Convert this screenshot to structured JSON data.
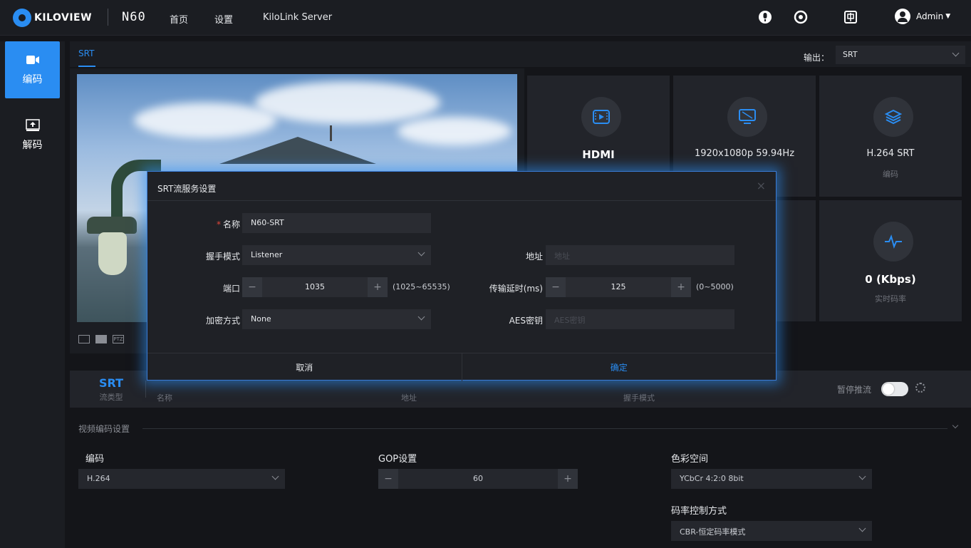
{
  "topbar": {
    "brand": "KILOVIEW",
    "model": "N60",
    "nav": [
      "首页",
      "设置",
      "KiloLink Server"
    ],
    "user": "Admin"
  },
  "sidebar": {
    "items": [
      {
        "label": "编码",
        "icon": "camera-icon",
        "active": true
      },
      {
        "label": "解码",
        "icon": "upload-icon",
        "active": false
      }
    ]
  },
  "main": {
    "tab": "SRT",
    "output_label": "输出：",
    "output_value": "SRT"
  },
  "preview": {
    "icons": [
      "layout-icon",
      "split-icon",
      "PTZ"
    ]
  },
  "cards": [
    {
      "value": "HDMI",
      "sub": "",
      "icon": "video-input-icon"
    },
    {
      "value": "1920x1080p 59.94Hz",
      "sub": "",
      "icon": "monitor-icon"
    },
    {
      "value": "H.264 SRT",
      "sub": "编码",
      "icon": "layers-icon"
    },
    {
      "value": "0 (Kbps)",
      "sub": "实时码率",
      "icon": "pulse-icon"
    }
  ],
  "stream": {
    "type": "SRT",
    "type_label": "流类型",
    "name_label": "名称",
    "addr_label": "地址",
    "mode_label": "握手模式",
    "pause_label": "暂停推流"
  },
  "video_settings": {
    "title": "视频编码设置",
    "codec_label": "编码",
    "codec_value": "H.264",
    "gop_label": "GOP设置",
    "gop_value": "60",
    "color_label": "色彩空间",
    "color_value": "YCbCr 4:2:0 8bit",
    "rate_label": "码率控制方式",
    "rate_value": "CBR-恒定码率模式"
  },
  "modal": {
    "title": "SRT流服务设置",
    "close": "×",
    "name_label": "名称",
    "name_value": "N60-SRT",
    "mode_label": "握手模式",
    "mode_value": "Listener",
    "addr_label": "地址",
    "addr_placeholder": "地址",
    "port_label": "端口",
    "port_value": "1035",
    "port_range": "(1025~65535)",
    "latency_label": "传输延时(ms)",
    "latency_value": "125",
    "latency_range": "(0~5000)",
    "enc_label": "加密方式",
    "enc_value": "None",
    "aes_label": "AES密钥",
    "aes_placeholder": "AES密钥",
    "cancel": "取消",
    "ok": "确定"
  },
  "colors": {
    "accent": "#2a8df2",
    "required": "#e0453a"
  }
}
